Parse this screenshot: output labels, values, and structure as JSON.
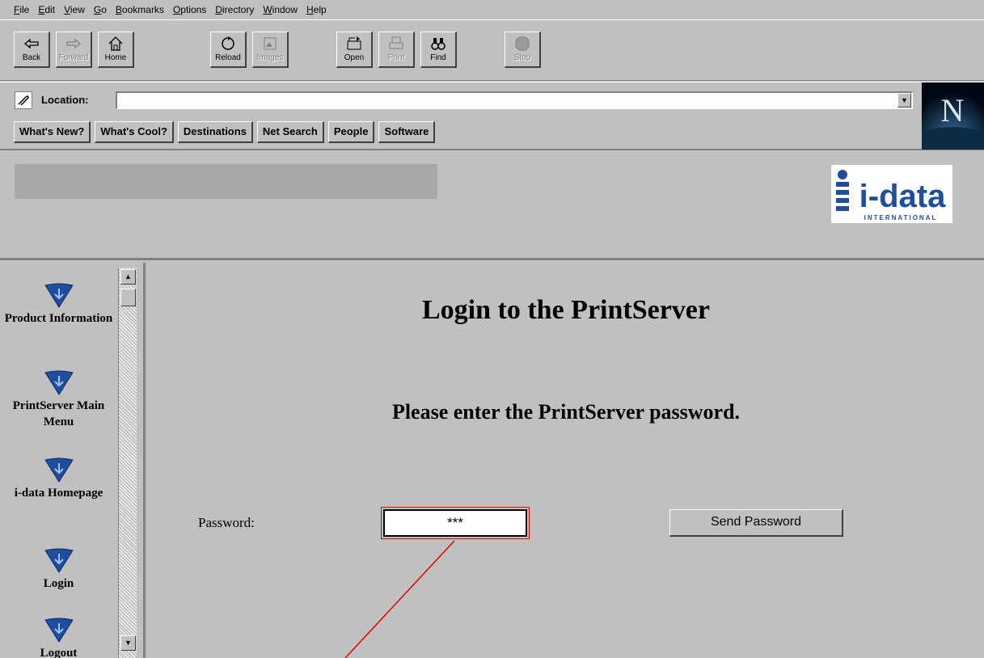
{
  "menu": [
    "File",
    "Edit",
    "View",
    "Go",
    "Bookmarks",
    "Options",
    "Directory",
    "Window",
    "Help"
  ],
  "toolbar": {
    "back": "Back",
    "forward": "Forward",
    "home": "Home",
    "reload": "Reload",
    "images": "Images",
    "open": "Open",
    "print": "Print",
    "find": "Find",
    "stop": "Stop"
  },
  "location": {
    "label": "Location:",
    "value": ""
  },
  "directory_buttons": [
    "What's New?",
    "What's Cool?",
    "Destinations",
    "Net Search",
    "People",
    "Software"
  ],
  "brand": {
    "logo_text": "i-data",
    "logo_subtext": "INTERNATIONAL",
    "browser_logo": "N",
    "accent_color": "#1f4e9c",
    "annotation_color": "#e00000"
  },
  "nav": {
    "items": [
      {
        "label": "Product Information"
      },
      {
        "label": "PrintServer Main Menu"
      },
      {
        "label": "i-data Homepage"
      },
      {
        "label": "Login"
      },
      {
        "label": "Logout"
      }
    ]
  },
  "main": {
    "title": "Login to the PrintServer",
    "subtitle": "Please enter the PrintServer password.",
    "password_label": "Password:",
    "password_value": "***",
    "send_button": "Send Password"
  }
}
